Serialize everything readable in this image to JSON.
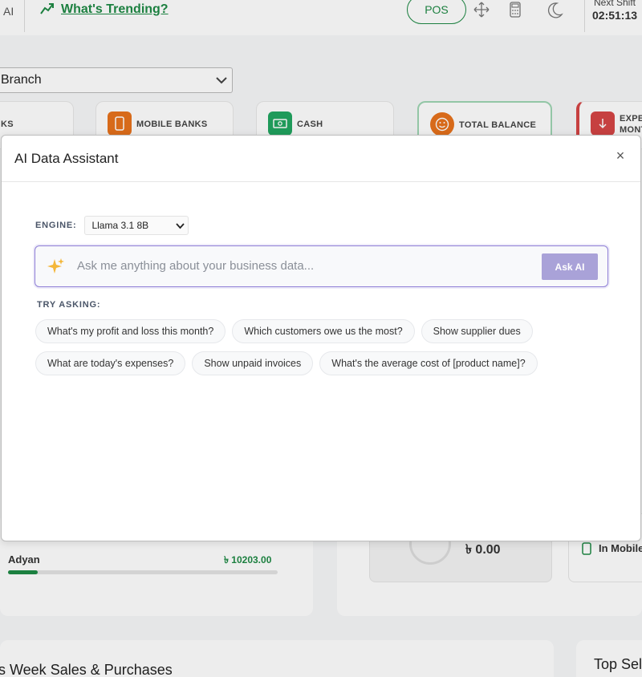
{
  "topbar": {
    "ai_label": "AI",
    "trending_label": "What's Trending?",
    "pos_label": "POS",
    "next_shift_label": "Next Shift",
    "next_shift_time": "02:51:13"
  },
  "dashboard": {
    "branch_select": "Branch",
    "cards": [
      {
        "label": "KS"
      },
      {
        "label": "MOBILE BANKS"
      },
      {
        "label": "CASH"
      },
      {
        "label": "TOTAL BALANCE"
      },
      {
        "label": "EXPE MONT"
      }
    ],
    "customer_name": "Adyan",
    "customer_value": "৳ 10203.00",
    "customer_progress": 0.11,
    "balance_value": "৳ 0.00",
    "mobile_label": "In Mobile",
    "weekly_title": "s Week Sales & Purchases",
    "top_title": "Top Sel"
  },
  "modal": {
    "title": "AI Data Assistant",
    "close": "×",
    "engine_label": "ENGINE:",
    "engine_value": "Llama 3.1 8B",
    "placeholder": "Ask me anything about your business data...",
    "ask_button": "Ask AI",
    "try_label": "TRY ASKING:",
    "suggestions": [
      [
        "What's my profit and loss this month?",
        "Which customers owe us the most?",
        "Show supplier dues"
      ],
      [
        "What are today's expenses?",
        "Show unpaid invoices",
        "What's the average cost of [product name]?"
      ]
    ]
  },
  "colors": {
    "accent": "#8f7fd6",
    "ask_button": "#a9a2d8",
    "brand_green": "#1f8a45"
  }
}
